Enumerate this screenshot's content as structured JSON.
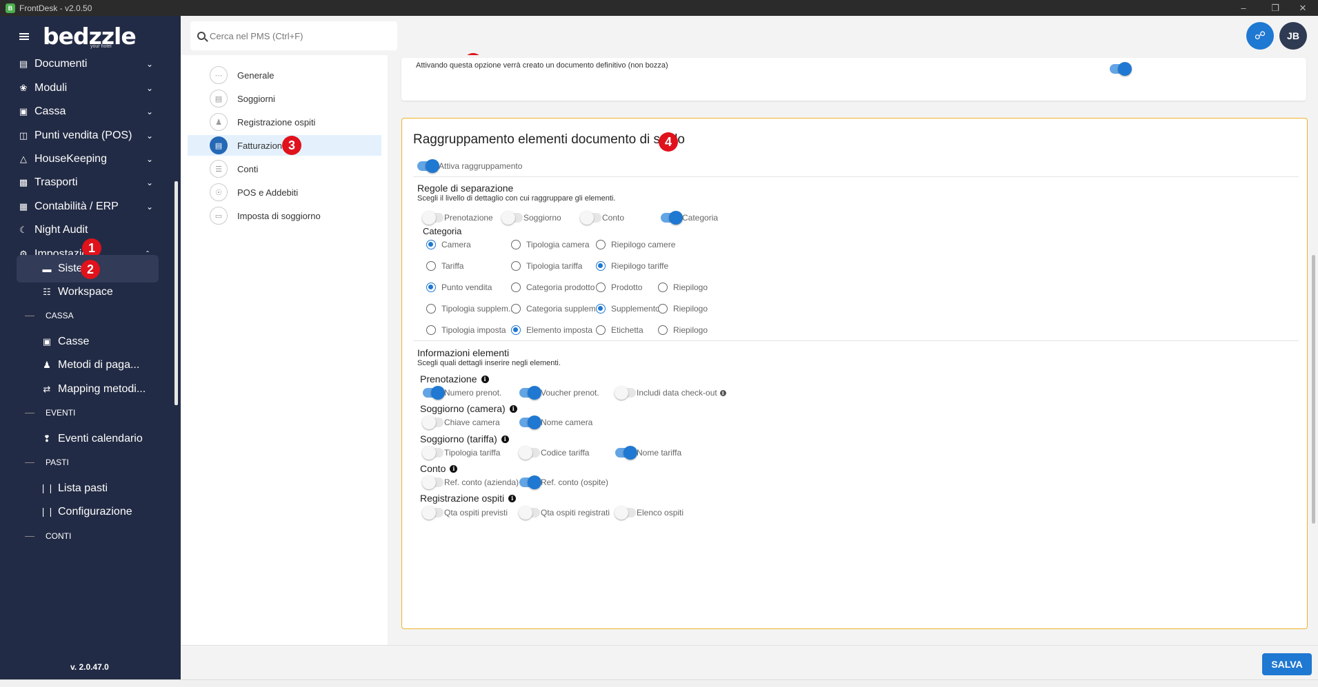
{
  "window": {
    "title": "FrontDesk - v2.0.50"
  },
  "sidebar": {
    "logo": "bedzzle",
    "logo_sub": "your hotel",
    "items": [
      {
        "label": "Documenti",
        "icon": "document-icon"
      },
      {
        "label": "Moduli",
        "icon": "puzzle-icon"
      },
      {
        "label": "Cassa",
        "icon": "cash-icon"
      },
      {
        "label": "Punti vendita (POS)",
        "icon": "shopping-bag-icon"
      },
      {
        "label": "HouseKeeping",
        "icon": "broom-icon"
      },
      {
        "label": "Trasporti",
        "icon": "car-icon"
      },
      {
        "label": "Contabilità / ERP",
        "icon": "ledger-icon"
      },
      {
        "label": "Night Audit",
        "icon": "night-audit-icon"
      },
      {
        "label": "Impostazioni",
        "icon": "gear-icon"
      }
    ],
    "sub_items": {
      "sistema": "Sistema",
      "workspace": "Workspace",
      "casse": "Casse",
      "metodi": "Metodi di paga...",
      "mapping": "Mapping metodi...",
      "eventi_cal": "Eventi calendario",
      "lista_pasti": "Lista pasti",
      "configurazione": "Configurazione"
    },
    "sections": {
      "cassa": "CASSA",
      "eventi": "EVENTI",
      "pasti": "PASTI",
      "conti": "CONTI"
    },
    "version": "v. 2.0.47.0"
  },
  "badges": {
    "b1": "1",
    "b2": "2",
    "b3": "3",
    "b4": "4"
  },
  "topbar": {
    "search_placeholder": "Cerca nel PMS (Ctrl+F)",
    "user_initials": "JB"
  },
  "settings_menu": [
    {
      "label": "Generale",
      "icon": "grid-icon"
    },
    {
      "label": "Soggiorni",
      "icon": "bed-icon"
    },
    {
      "label": "Registrazione ospiti",
      "icon": "user-icon"
    },
    {
      "label": "Fatturazione",
      "icon": "invoice-icon",
      "active": true
    },
    {
      "label": "Conti",
      "icon": "list-icon"
    },
    {
      "label": "POS e Addebiti",
      "icon": "cart-icon"
    },
    {
      "label": "Imposta di soggiorno",
      "icon": "file-icon"
    }
  ],
  "top_card": {
    "text": "Attivando questa opzione verrà creato un documento definitivo (non bozza)",
    "toggle_on": true
  },
  "card": {
    "title": "Raggruppamento elementi documento di saldo",
    "attiva_label": "Attiva raggruppamento",
    "attiva_on": true,
    "regole": {
      "title": "Regole di separazione",
      "subtitle": "Scegli il livello di dettaglio con cui raggruppare gli elementi.",
      "toggles": [
        {
          "label": "Prenotazione",
          "on": false
        },
        {
          "label": "Soggiorno",
          "on": false
        },
        {
          "label": "Conto",
          "on": false
        },
        {
          "label": "Categoria",
          "on": true
        }
      ]
    },
    "categoria": {
      "title": "Categoria",
      "rows": [
        [
          {
            "label": "Camera",
            "on": true
          },
          {
            "label": "Tipologia camera",
            "on": false
          },
          {
            "label": "Riepilogo camere",
            "on": false
          }
        ],
        [
          {
            "label": "Tariffa",
            "on": false
          },
          {
            "label": "Tipologia tariffa",
            "on": false
          },
          {
            "label": "Riepilogo tariffe",
            "on": true
          }
        ],
        [
          {
            "label": "Punto vendita",
            "on": true
          },
          {
            "label": "Categoria prodotto",
            "on": false
          },
          {
            "label": "Prodotto",
            "on": false
          },
          {
            "label": "Riepilogo",
            "on": false
          }
        ],
        [
          {
            "label": "Tipologia supplem...",
            "on": false
          },
          {
            "label": "Categoria supplem...",
            "on": false
          },
          {
            "label": "Supplemento",
            "on": true
          },
          {
            "label": "Riepilogo",
            "on": false
          }
        ],
        [
          {
            "label": "Tipologia imposta",
            "on": false
          },
          {
            "label": "Elemento imposta",
            "on": true
          },
          {
            "label": "Etichetta",
            "on": false
          },
          {
            "label": "Riepilogo",
            "on": false
          }
        ]
      ]
    },
    "info": {
      "title": "Informazioni elementi",
      "subtitle": "Scegli quali dettagli inserire negli elementi.",
      "groups": [
        {
          "label": "Prenotazione",
          "toggles": [
            {
              "label": "Numero prenot.",
              "on": true
            },
            {
              "label": "Voucher prenot.",
              "on": true
            },
            {
              "label": "Includi data check-out",
              "on": false
            }
          ]
        },
        {
          "label": "Soggiorno (camera)",
          "toggles": [
            {
              "label": "Chiave camera",
              "on": false
            },
            {
              "label": "Nome camera",
              "on": true
            }
          ]
        },
        {
          "label": "Soggiorno (tariffa)",
          "toggles": [
            {
              "label": "Tipologia tariffa",
              "on": false
            },
            {
              "label": "Codice tariffa",
              "on": false
            },
            {
              "label": "Nome tariffa",
              "on": true
            }
          ]
        },
        {
          "label": "Conto",
          "toggles": [
            {
              "label": "Ref. conto (azienda)",
              "on": false
            },
            {
              "label": "Ref. conto (ospite)",
              "on": true
            }
          ]
        },
        {
          "label": "Registrazione ospiti",
          "toggles": [
            {
              "label": "Qta ospiti previsti",
              "on": false
            },
            {
              "label": "Qta ospiti registrati",
              "on": false
            },
            {
              "label": "Elenco ospiti",
              "on": false
            }
          ]
        }
      ]
    }
  },
  "footer": {
    "save_label": "SALVA"
  },
  "colors": {
    "sidebar_bg": "#222b45",
    "accent": "#1f78d1",
    "badge": "#e0121b",
    "card_border": "#f0b429"
  }
}
